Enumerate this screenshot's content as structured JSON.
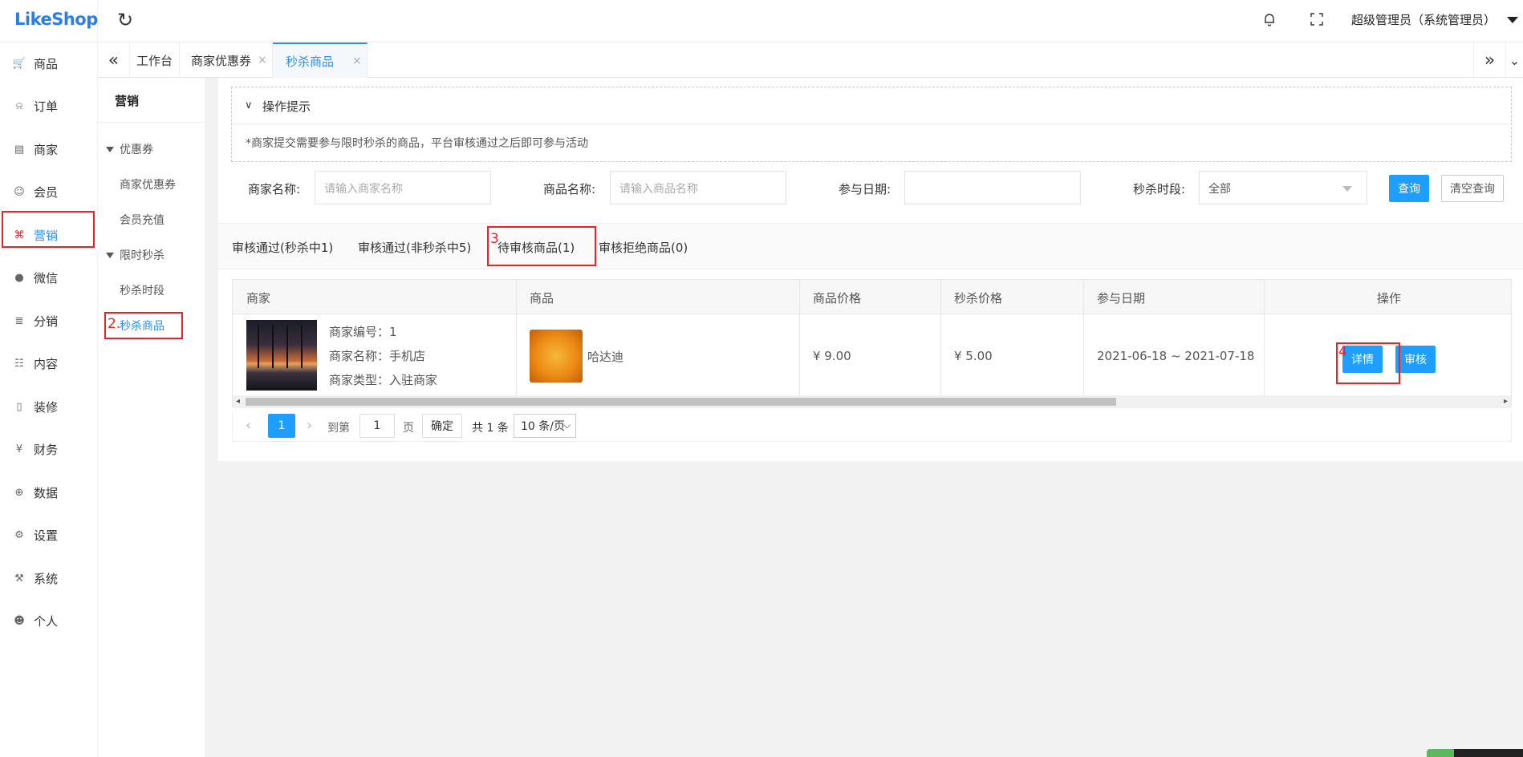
{
  "brand": {
    "logo": "LikeShop"
  },
  "header": {
    "user": "超级管理员（系统管理员）"
  },
  "nav": [
    {
      "label": "商品",
      "icon": "cart-icon"
    },
    {
      "label": "订单",
      "icon": "bell-outline-icon"
    },
    {
      "label": "商家",
      "icon": "building-icon"
    },
    {
      "label": "会员",
      "icon": "user-icon"
    },
    {
      "label": "营销",
      "icon": "gift-icon"
    },
    {
      "label": "微信",
      "icon": "wechat-icon"
    },
    {
      "label": "分销",
      "icon": "layers-icon"
    },
    {
      "label": "内容",
      "icon": "book-icon"
    },
    {
      "label": "装修",
      "icon": "phone-icon"
    },
    {
      "label": "财务",
      "icon": "yen-icon"
    },
    {
      "label": "数据",
      "icon": "globe-icon"
    },
    {
      "label": "设置",
      "icon": "gear-icon"
    },
    {
      "label": "系统",
      "icon": "tools-icon"
    },
    {
      "label": "个人",
      "icon": "person-icon"
    }
  ],
  "page_tabs": [
    {
      "label": "工作台"
    },
    {
      "label": "商家优惠券",
      "close": "×"
    },
    {
      "label": "秒杀商品",
      "close": "×"
    }
  ],
  "submenu": {
    "title": "营销",
    "group1": "优惠券",
    "item1": "商家优惠券",
    "item2": "会员充值",
    "group2": "限时秒杀",
    "item3": "秒杀时段",
    "item4": "秒杀商品"
  },
  "annotations": {
    "n2": "2.",
    "n3": "3",
    "n4": "4"
  },
  "tips": {
    "title": "操作提示",
    "text": "*商家提交需要参与限时秒杀的商品，平台审核通过之后即可参与活动"
  },
  "filters": {
    "shop_label": "商家名称:",
    "shop_placeholder": "请输入商家名称",
    "goods_label": "商品名称:",
    "goods_placeholder": "请输入商品名称",
    "date_label": "参与日期:",
    "time_label": "秒杀时段:",
    "time_value": "全部",
    "query": "查询",
    "reset": "清空查询"
  },
  "status_tabs": [
    "审核通过(秒杀中1)",
    "审核通过(非秒杀中5)",
    "待审核商品(1)",
    "审核拒绝商品(0)"
  ],
  "table": {
    "headers": [
      "商家",
      "商品",
      "商品价格",
      "秒杀价格",
      "参与日期",
      "操作"
    ],
    "row": {
      "shop_no": "商家编号：1",
      "shop_name": "商家名称：手机店",
      "shop_type": "商家类型：入驻商家",
      "goods_name": "哈达迪",
      "price": "¥ 9.00",
      "seckill_price": "¥ 5.00",
      "date": "2021-06-18 ~ 2021-07-18",
      "btn_detail": "详情",
      "btn_audit": "审核"
    }
  },
  "pager": {
    "current": "1",
    "goto": "到第",
    "page_input": "1",
    "page_unit": "页",
    "confirm": "确定",
    "total": "共 1 条",
    "size": "10 条/页"
  },
  "colors": {
    "accent": "#1e9fff",
    "active": "#2f8ff0",
    "annotation": "#e8242a"
  }
}
